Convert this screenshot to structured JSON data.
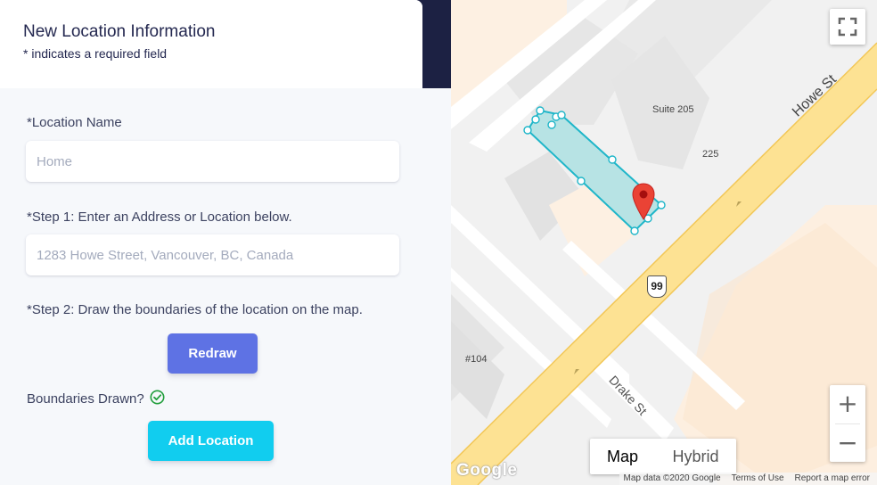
{
  "form": {
    "title": "New Location Information",
    "subtitle": "* indicates a required field",
    "location_name_label": "*Location Name",
    "location_name_placeholder": "Home",
    "step1_label": "*Step 1: Enter an Address or Location below.",
    "address_placeholder": "1283 Howe Street, Vancouver, BC, Canada",
    "step2_label": "*Step 2: Draw the boundaries of the location on the map.",
    "redraw_label": "Redraw",
    "boundaries_label": "Boundaries Drawn?",
    "add_location_label": "Add Location"
  },
  "map": {
    "street_howe": "Howe St",
    "street_drake": "Drake St",
    "label_suite": "Suite 205",
    "label_225": "225",
    "label_104": "#104",
    "route_shield": "99",
    "zoom_in": "+",
    "zoom_out": "−",
    "type_map": "Map",
    "type_hybrid": "Hybrid",
    "logo": "Google",
    "attribution": {
      "data": "Map data ©2020 Google",
      "terms": "Terms of Use",
      "report": "Report a map error"
    },
    "icons": {
      "fullscreen": "fullscreen-icon",
      "marker": "map-marker-icon",
      "check": "check-circle-icon"
    }
  },
  "colors": {
    "primary": "#5e72e4",
    "info": "#11cdef",
    "success": "#2dce89",
    "polygon": "#1fb6c9",
    "marker": "#ea4335",
    "road": "#fde293"
  }
}
